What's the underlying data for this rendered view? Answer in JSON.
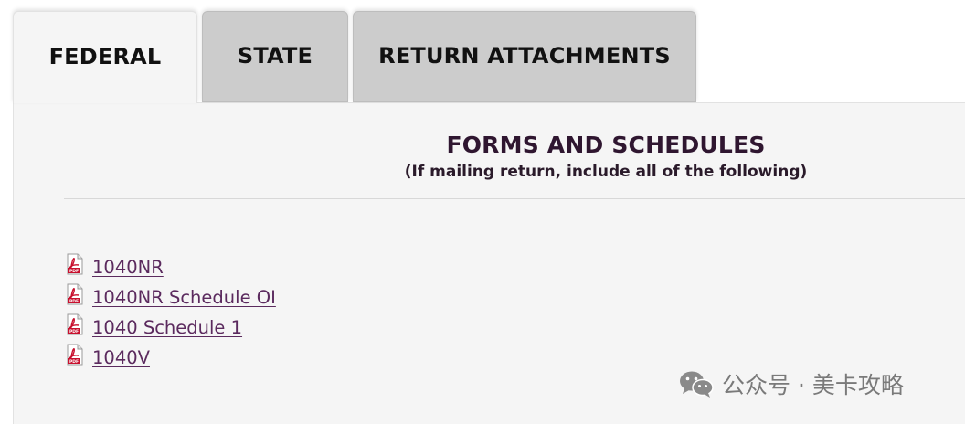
{
  "tabs": [
    {
      "label": "FEDERAL",
      "active": true
    },
    {
      "label": "STATE",
      "active": false
    },
    {
      "label": "RETURN ATTACHMENTS",
      "active": false
    }
  ],
  "section": {
    "title": "FORMS AND SCHEDULES",
    "subtitle": "(If mailing return, include all of the following)"
  },
  "forms": [
    {
      "label": "1040NR",
      "icon": "pdf-icon"
    },
    {
      "label": "1040NR Schedule OI",
      "icon": "pdf-icon"
    },
    {
      "label": "1040 Schedule 1",
      "icon": "pdf-icon"
    },
    {
      "label": "1040V",
      "icon": "pdf-icon"
    }
  ],
  "watermark": {
    "text": "公众号 · 美卡攻略",
    "icon": "wechat-icon"
  },
  "colors": {
    "active_tab_bg": "#f5f5f5",
    "inactive_tab_bg": "#cccccc",
    "link": "#5b2a5e",
    "title": "#2f1630",
    "pdf_red": "#c8102e"
  }
}
